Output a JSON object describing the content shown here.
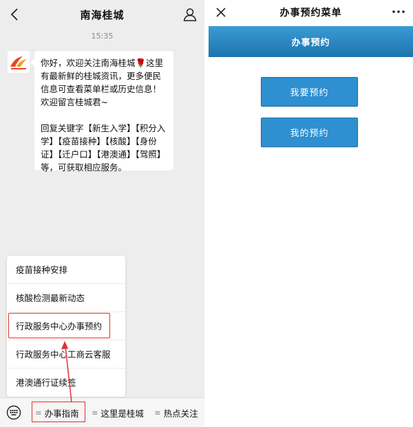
{
  "chat": {
    "title": "南海桂城",
    "time": "15:35",
    "message": {
      "line1": "你好，欢迎关注南海桂城",
      "line1_rest": "这里有最新鲜的桂城资讯，更多便民信息可查看菜单栏或历史信息！欢迎留言桂城君~",
      "line2": "回复关键字【新生入学】【积分入学】【疫苗接种】【核酸】【身份证】【迁户口】【港澳通】【驾照】等，可获取相应服务。"
    },
    "menu": [
      "疫苗接种安排",
      "核酸检测最新动态",
      "行政服务中心办事预约",
      "行政服务中心工商云客服",
      "港澳通行证续签"
    ],
    "tabs": [
      "办事指南",
      "这里是桂城",
      "热点关注"
    ]
  },
  "booking": {
    "header_title": "办事预约菜单",
    "banner": "办事预约",
    "btn_book": "我要预约",
    "btn_mine": "我的预约"
  },
  "colors": {
    "accent_blue": "#2e8fd1",
    "highlight_red": "#e0312f",
    "chat_bg": "#ededed"
  },
  "icons": {
    "back": "chevron-left-icon",
    "profile": "person-icon",
    "keyboard": "keyboard-icon",
    "close": "close-icon",
    "more": "more-dots-icon",
    "rose": "rose-icon"
  }
}
